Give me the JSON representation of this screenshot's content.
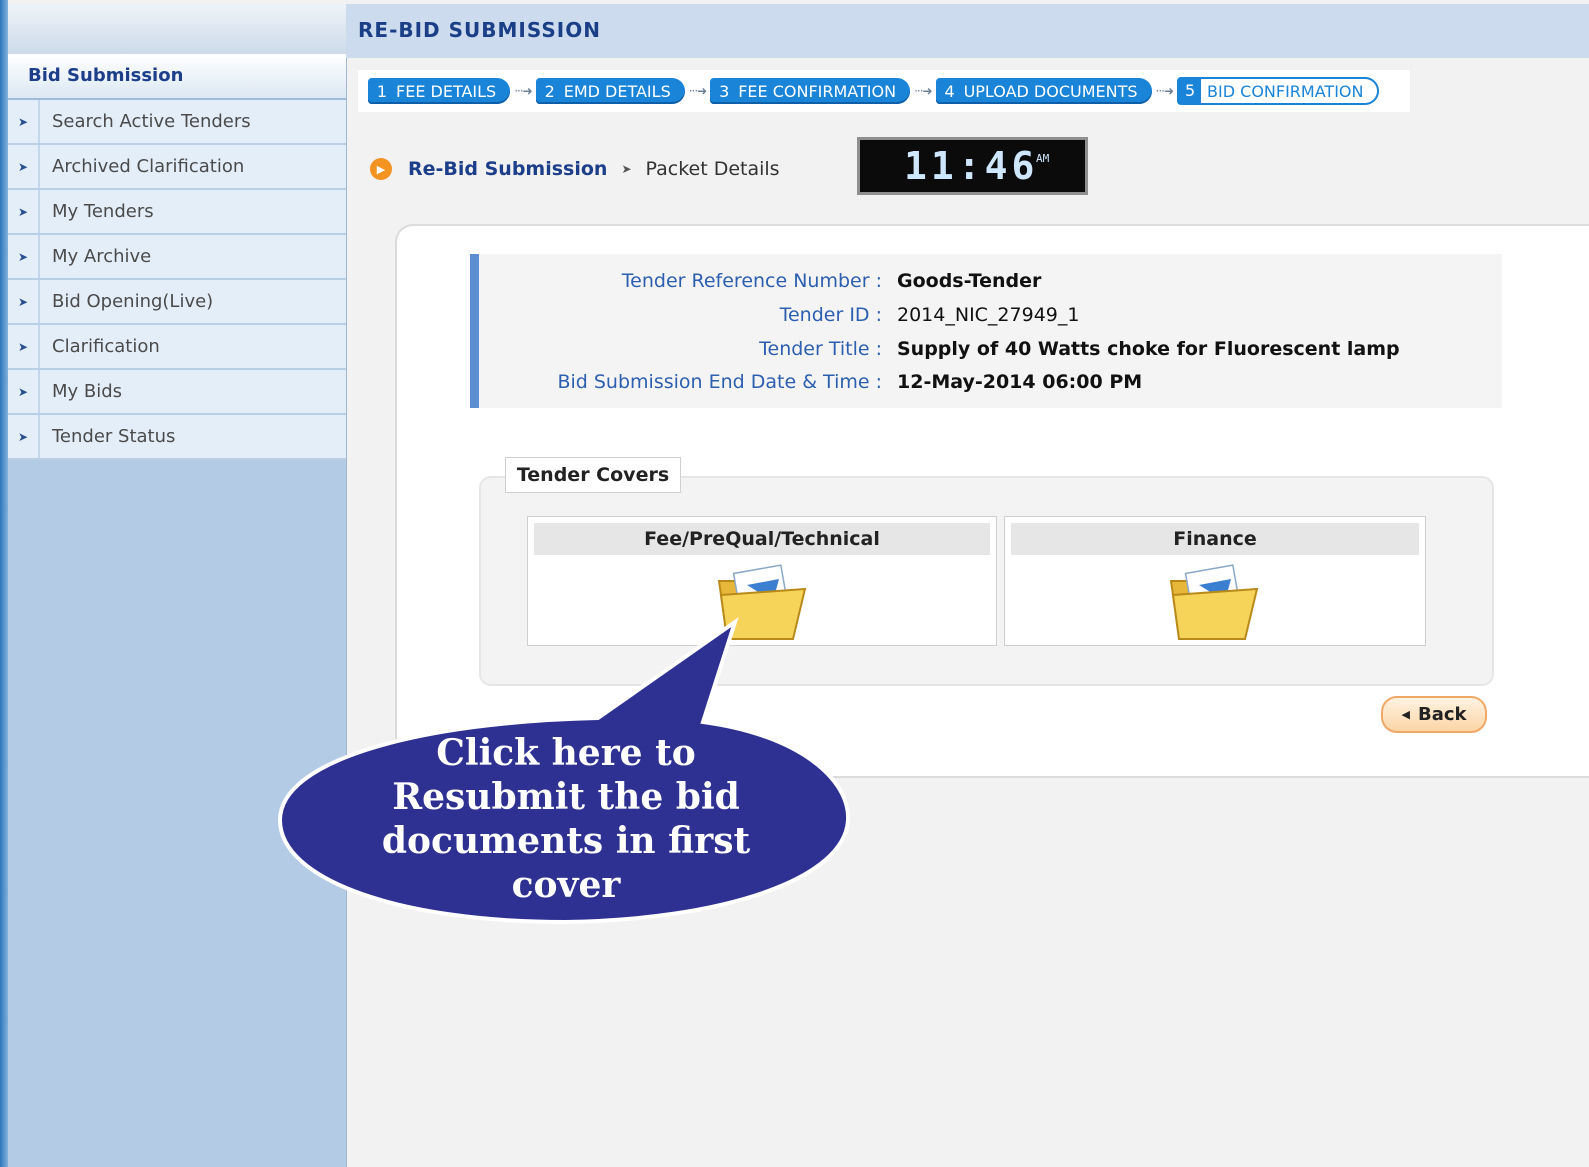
{
  "sidebar": {
    "title": "Bid Submission",
    "items": [
      {
        "label": "Search Active Tenders"
      },
      {
        "label": "Archived Clarification"
      },
      {
        "label": "My Tenders"
      },
      {
        "label": "My Archive"
      },
      {
        "label": "Bid Opening(Live)"
      },
      {
        "label": "Clarification"
      },
      {
        "label": "My Bids"
      },
      {
        "label": "Tender Status"
      }
    ]
  },
  "header": {
    "title": "RE-BID SUBMISSION"
  },
  "steps": [
    {
      "num": "1",
      "label": "FEE DETAILS"
    },
    {
      "num": "2",
      "label": "EMD DETAILS"
    },
    {
      "num": "3",
      "label": "FEE CONFIRMATION"
    },
    {
      "num": "4",
      "label": "UPLOAD DOCUMENTS"
    },
    {
      "num": "5",
      "label": "BID CONFIRMATION"
    }
  ],
  "breadcrumb": {
    "current": "Re-Bid Submission",
    "sub": "Packet Details"
  },
  "clock": {
    "time": "11:46",
    "ampm": "AM"
  },
  "tender": {
    "ref_label": "Tender Reference Number :",
    "ref_value": "Goods-Tender",
    "id_label": "Tender ID :",
    "id_value": "2014_NIC_27949_1",
    "title_label": "Tender Title :",
    "title_value": "Supply of 40 Watts choke for Fluorescent lamp",
    "end_label": "Bid Submission End Date & Time :",
    "end_value": "12-May-2014 06:00 PM"
  },
  "covers": {
    "legend": "Tender Covers",
    "items": [
      {
        "label": "Fee/PreQual/Technical"
      },
      {
        "label": "Finance"
      }
    ]
  },
  "back_label": "Back",
  "callout": {
    "lines": [
      "Click here to",
      "Resubmit the bid",
      "documents in first",
      "cover"
    ]
  },
  "colors": {
    "accent": "#1a84d8",
    "brand": "#1a3f87",
    "callout": "#2e3192",
    "back_button": "#fcd5a6"
  }
}
